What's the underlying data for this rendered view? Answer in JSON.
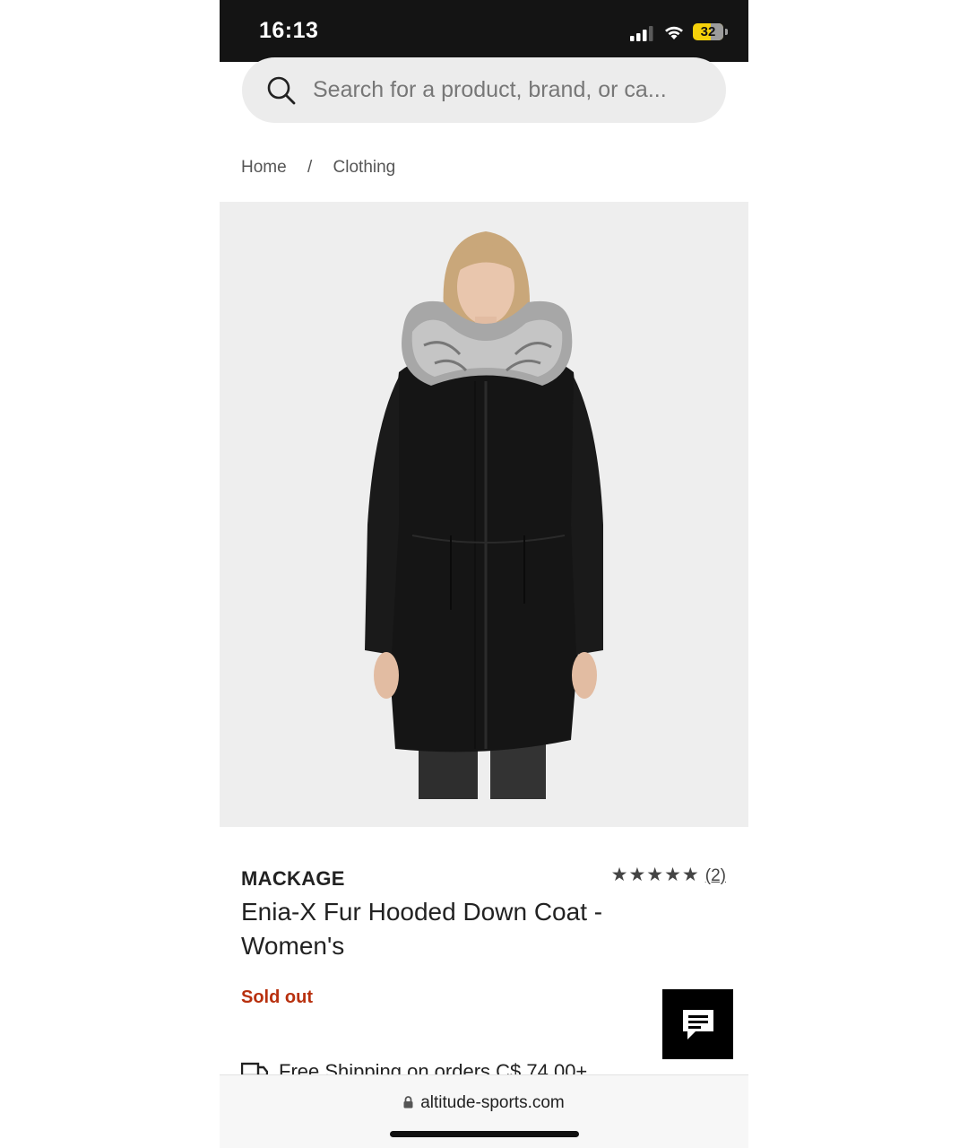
{
  "status_bar": {
    "time": "16:13",
    "battery": "32",
    "icons": [
      "cellular-signal-icon",
      "wifi-icon",
      "battery-icon"
    ]
  },
  "search": {
    "placeholder": "Search for a product, brand, or ca..."
  },
  "breadcrumb": {
    "items": [
      "Home",
      "Clothing"
    ],
    "separator": "/"
  },
  "product": {
    "image_description": "Woman in black fur-hooded down coat",
    "brand": "MACKAGE",
    "title": "Enia-X Fur Hooded Down Coat - Women's",
    "rating_stars": "★★★★★",
    "rating": 5,
    "review_count": "(2)",
    "stock_status": "Sold out",
    "shipping_text": "Free Shipping on orders C$ 74.00+"
  },
  "browser": {
    "url": "altitude-sports.com"
  },
  "colors": {
    "accent_sold_out": "#b8300e",
    "status_bar_bg": "#141414",
    "battery": "#f5d10a",
    "chat_button": "#000000"
  }
}
